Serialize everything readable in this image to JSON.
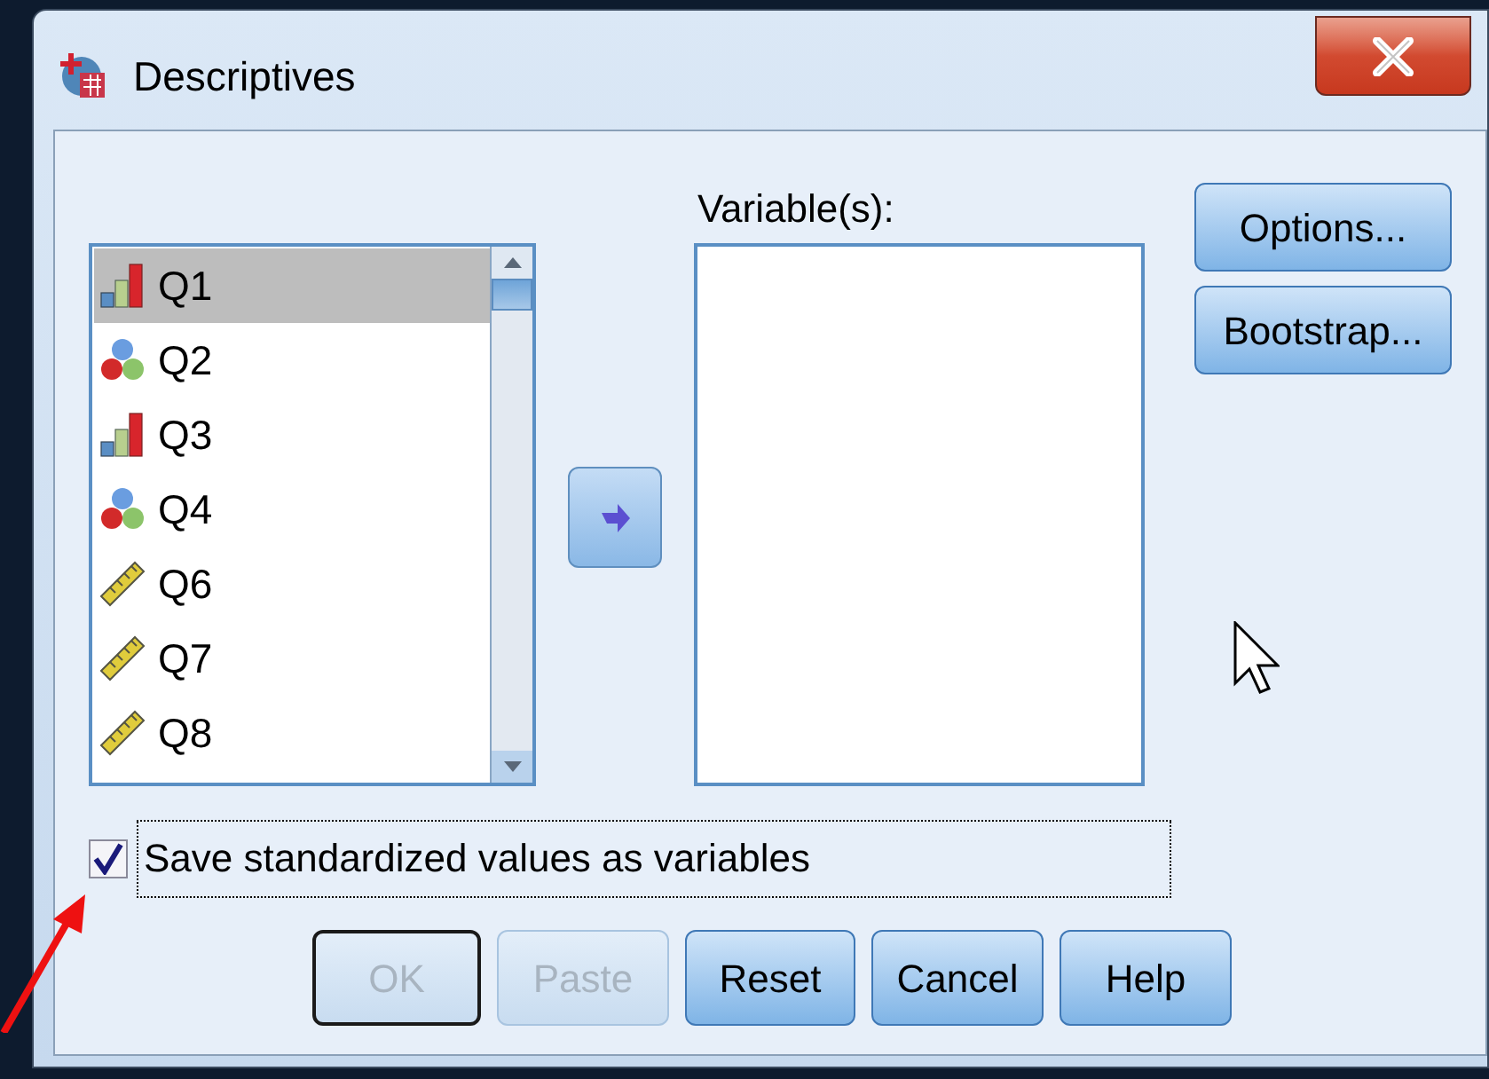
{
  "window": {
    "title": "Descriptives"
  },
  "source_list": {
    "items": [
      {
        "label": "Q1",
        "kind": "ordinal",
        "selected": true
      },
      {
        "label": "Q2",
        "kind": "nominal",
        "selected": false
      },
      {
        "label": "Q3",
        "kind": "ordinal",
        "selected": false
      },
      {
        "label": "Q4",
        "kind": "nominal",
        "selected": false
      },
      {
        "label": "Q6",
        "kind": "scale",
        "selected": false
      },
      {
        "label": "Q7",
        "kind": "scale",
        "selected": false
      },
      {
        "label": "Q8",
        "kind": "scale",
        "selected": false
      }
    ]
  },
  "target_list": {
    "label": "Variable(s):"
  },
  "side_buttons": [
    {
      "label": "Options..."
    },
    {
      "label": "Bootstrap..."
    }
  ],
  "save_option": {
    "label": "Save standardized values as variables",
    "checked": true
  },
  "buttons": [
    {
      "label": "OK",
      "disabled": true,
      "default": true
    },
    {
      "label": "Paste",
      "disabled": true,
      "default": false
    },
    {
      "label": "Reset",
      "disabled": false,
      "default": false
    },
    {
      "label": "Cancel",
      "disabled": false,
      "default": false
    },
    {
      "label": "Help",
      "disabled": false,
      "default": false
    }
  ]
}
